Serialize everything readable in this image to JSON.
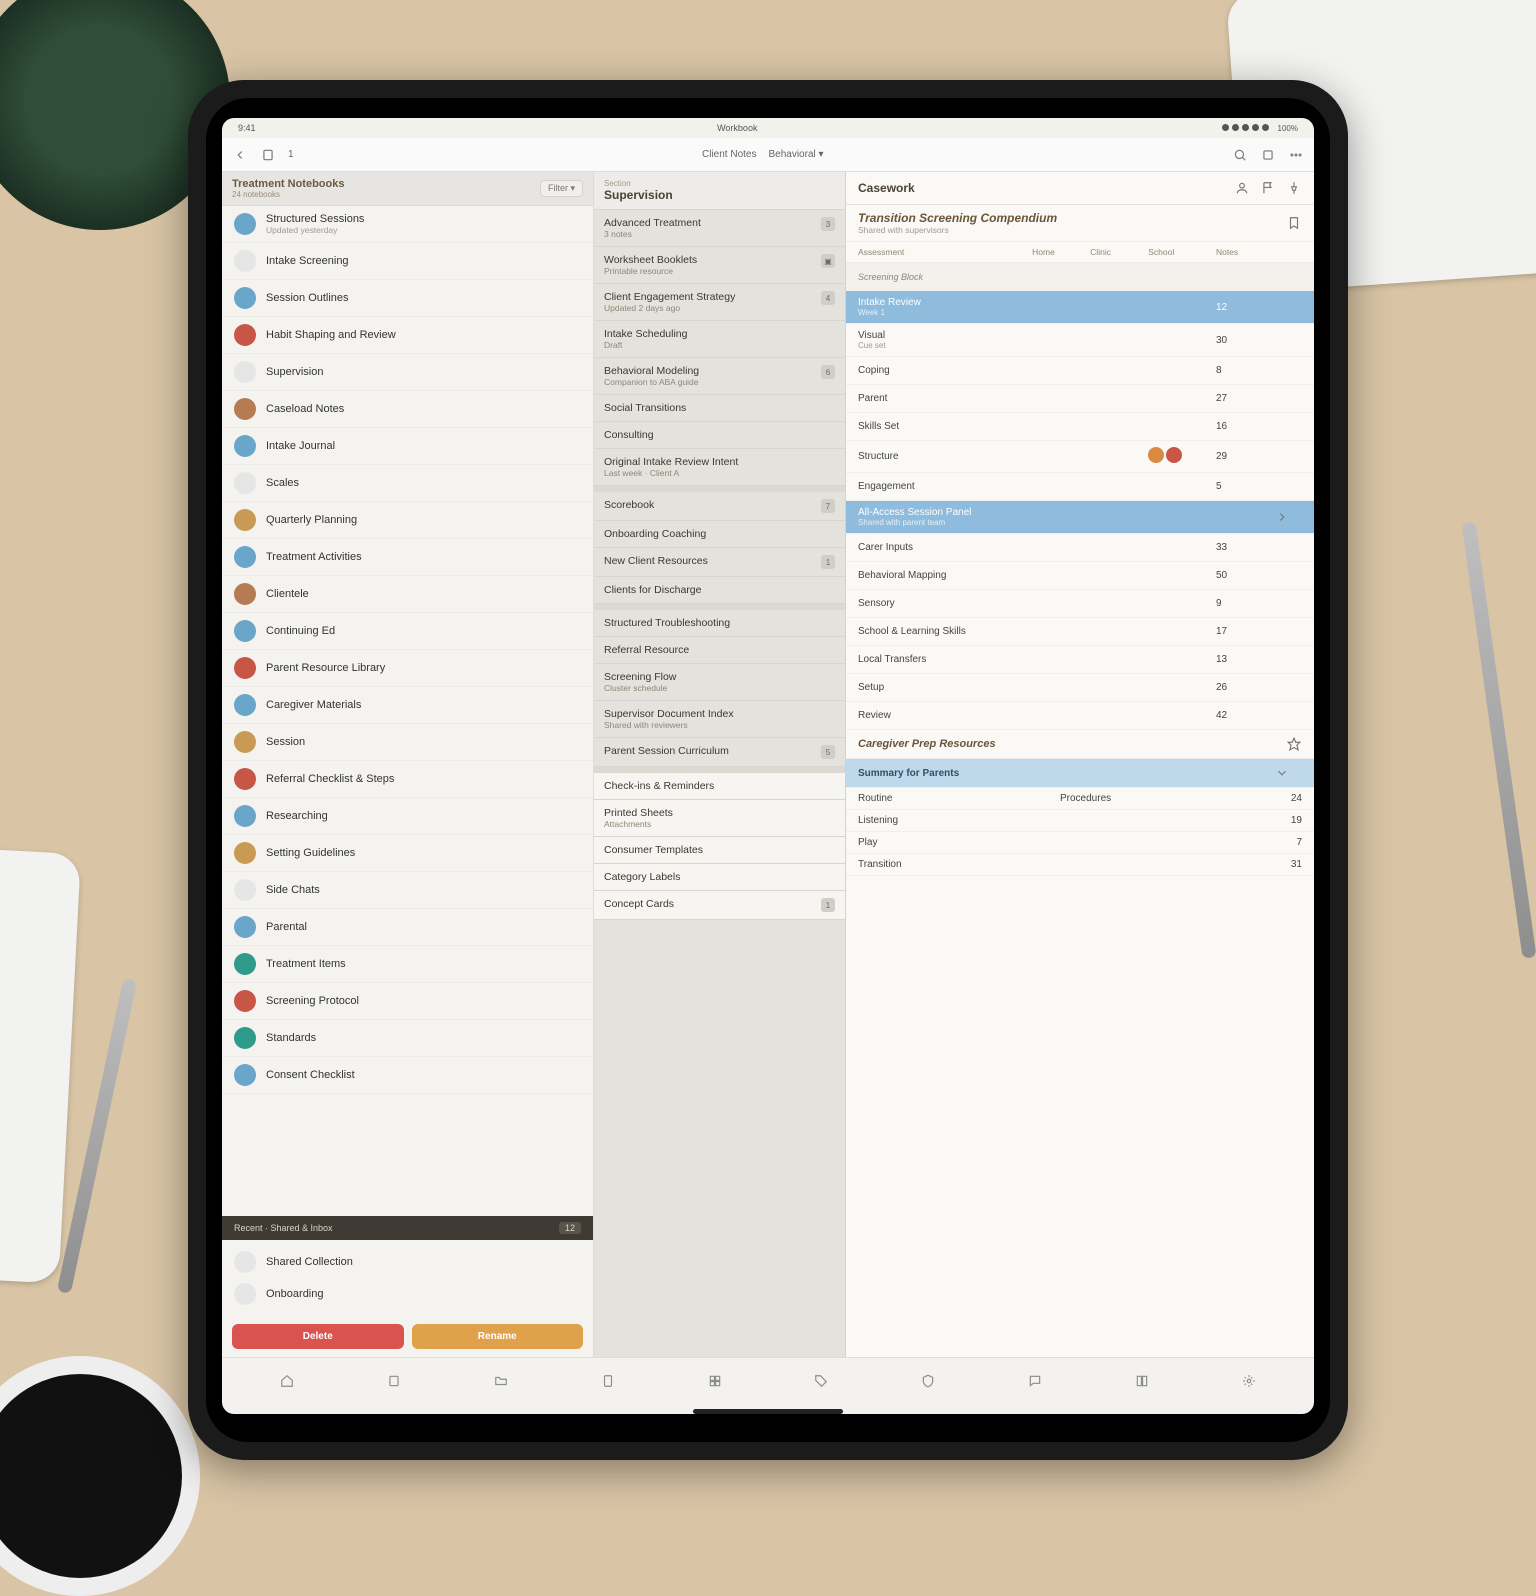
{
  "status": {
    "left": "9:41",
    "center": "Workbook",
    "right": "100%"
  },
  "toolbar": {
    "crumb1": "Client Notes",
    "crumb2": "Behavioral ▾"
  },
  "left": {
    "headerTitle": "Treatment Notebooks",
    "headerSub": "24 notebooks",
    "pill": "Filter ▾",
    "items": [
      {
        "color": "#6aa6c9",
        "t": "Structured Sessions",
        "s": "Updated yesterday"
      },
      {
        "color": "#e6e6e6",
        "t": "Intake Screening",
        "s": ""
      },
      {
        "color": "#6aa6c9",
        "t": "Session Outlines",
        "s": ""
      },
      {
        "color": "#c75647",
        "t": "Habit Shaping and Review",
        "s": ""
      },
      {
        "color": "#e6e6e6",
        "t": "Supervision",
        "s": ""
      },
      {
        "color": "#b57b52",
        "t": "Caseload Notes",
        "s": ""
      },
      {
        "color": "#6aa6c9",
        "t": "Intake Journal",
        "s": ""
      },
      {
        "color": "#e6e6e6",
        "t": "Scales",
        "s": ""
      },
      {
        "color": "#c99a54",
        "t": "Quarterly Planning",
        "s": ""
      },
      {
        "color": "#6aa6c9",
        "t": "Treatment Activities",
        "s": ""
      },
      {
        "color": "#b57b52",
        "t": "Clientele",
        "s": ""
      },
      {
        "color": "#6aa6c9",
        "t": "Continuing Ed",
        "s": ""
      },
      {
        "color": "#c75647",
        "t": "Parent Resource Library",
        "s": ""
      },
      {
        "color": "#6aa6c9",
        "t": "Caregiver Materials",
        "s": ""
      },
      {
        "color": "#c99a54",
        "t": "Session",
        "s": ""
      },
      {
        "color": "#c75647",
        "t": "Referral Checklist & Steps",
        "s": ""
      },
      {
        "color": "#6aa6c9",
        "t": "Researching",
        "s": ""
      },
      {
        "color": "#c99a54",
        "t": "Setting Guidelines",
        "s": ""
      },
      {
        "color": "#e6e6e6",
        "t": "Side Chats",
        "s": ""
      },
      {
        "color": "#6aa6c9",
        "t": "Parental",
        "s": ""
      },
      {
        "color": "#309b8b",
        "t": "Treatment Items",
        "s": ""
      },
      {
        "color": "#c75647",
        "t": "Screening Protocol",
        "s": ""
      },
      {
        "color": "#309b8b",
        "t": "Standards",
        "s": ""
      },
      {
        "color": "#6aa6c9",
        "t": "Consent Checklist",
        "s": ""
      }
    ],
    "footerDark": {
      "label": "Recent · Shared & Inbox",
      "badge": "12"
    },
    "bottomItems": [
      {
        "color": "#e6e6e6",
        "t": "Shared Collection"
      },
      {
        "color": "#e6e6e6",
        "t": "Onboarding"
      }
    ],
    "btn1": "Delete",
    "btn2": "Rename"
  },
  "mid": {
    "sup": "Section",
    "title": "Supervision",
    "items": [
      {
        "t": "Advanced Treatment",
        "s": "3 notes",
        "b": "3"
      },
      {
        "t": "Worksheet Booklets",
        "s": "Printable resource",
        "b": "▣"
      },
      {
        "t": "Client Engagement Strategy",
        "s": "Updated 2 days ago",
        "b": "4"
      },
      {
        "t": "Intake Scheduling",
        "s": "Draft",
        "b": ""
      },
      {
        "t": "Behavioral Modeling",
        "s": "Companion to ABA guide",
        "b": "6"
      },
      {
        "t": "Social Transitions",
        "s": "",
        "b": ""
      },
      {
        "t": "Consulting",
        "s": "",
        "b": ""
      },
      {
        "t": "Original Intake Review Intent",
        "s": "Last week · Client A",
        "b": ""
      },
      {
        "t": "Scorebook",
        "s": "",
        "b": "7"
      },
      {
        "t": "Onboarding Coaching",
        "s": "",
        "b": ""
      },
      {
        "t": "New Client Resources",
        "s": "",
        "b": "1"
      },
      {
        "t": "Clients for Discharge",
        "s": "",
        "b": ""
      },
      {
        "t": "Structured Troubleshooting",
        "s": "",
        "b": ""
      },
      {
        "t": "Referral Resource",
        "s": "",
        "b": ""
      },
      {
        "t": "Screening Flow",
        "s": "Cluster schedule",
        "b": ""
      },
      {
        "t": "Supervisor Document Index",
        "s": "Shared with reviewers",
        "b": ""
      },
      {
        "t": "Parent Session Curriculum",
        "s": "",
        "b": "5"
      },
      {
        "t": "Check-ins & Reminders",
        "s": "",
        "b": ""
      },
      {
        "t": "Printed Sheets",
        "s": "Attachments",
        "b": ""
      },
      {
        "t": "Consumer Templates",
        "s": "",
        "b": ""
      },
      {
        "t": "Category Labels",
        "s": "",
        "b": ""
      },
      {
        "t": "Concept Cards",
        "s": "",
        "b": "1"
      }
    ]
  },
  "right": {
    "headTitle": "Casework",
    "subTitle": "Transition Screening Compendium",
    "subCaption": "Shared with supervisors",
    "thead": [
      "Assessment",
      "Home",
      "Clinic",
      "School",
      "Notes",
      ""
    ],
    "groupA": "Screening Block",
    "rowsA": [
      {
        "name": "Intake Review",
        "sub": "Week 1",
        "v": [
          "",
          "",
          "",
          "12"
        ],
        "hl": true
      },
      {
        "name": "Visual",
        "sub": "Cue set",
        "v": [
          "",
          "",
          "",
          "30"
        ]
      },
      {
        "name": "Coping",
        "sub": "",
        "v": [
          "",
          "",
          "",
          "8"
        ]
      },
      {
        "name": "Parent",
        "sub": "",
        "v": [
          "",
          "",
          "",
          "27"
        ]
      },
      {
        "name": "Skills Set",
        "sub": "",
        "v": [
          "",
          "",
          "",
          "16"
        ]
      },
      {
        "name": "Structure",
        "sub": "",
        "v": [
          "",
          "",
          "",
          "29"
        ],
        "icons": true
      },
      {
        "name": "Engagement",
        "sub": "",
        "v": [
          "",
          "",
          "",
          "5"
        ]
      }
    ],
    "groupB": {
      "t": "All-Access Session Panel",
      "s": "Shared with parent team"
    },
    "rowsB": [
      {
        "name": "Carer Inputs",
        "v": [
          "",
          "",
          "",
          "33"
        ]
      },
      {
        "name": "Behavioral Mapping",
        "v": [
          "",
          "",
          "",
          "50"
        ]
      },
      {
        "name": "Sensory",
        "v": [
          "",
          "",
          "",
          "9"
        ]
      },
      {
        "name": "School & Learning Skills",
        "v": [
          "",
          "",
          "",
          "17"
        ]
      },
      {
        "name": "Local Transfers",
        "v": [
          "",
          "",
          "",
          "13"
        ]
      },
      {
        "name": "Setup",
        "v": [
          "",
          "",
          "",
          "26"
        ],
        "chip": true
      },
      {
        "name": "Review",
        "v": [
          "",
          "",
          "",
          "42"
        ]
      }
    ],
    "sectionC": "Caregiver Prep Resources",
    "groupD": "Summary for Parents",
    "rowsD": [
      {
        "a": "Routine",
        "b": "Procedures",
        "c": "24"
      },
      {
        "a": "Listening",
        "b": "",
        "c": "19"
      },
      {
        "a": "Play",
        "b": "",
        "c": "7"
      },
      {
        "a": "Transition",
        "b": "",
        "c": "31"
      }
    ]
  }
}
